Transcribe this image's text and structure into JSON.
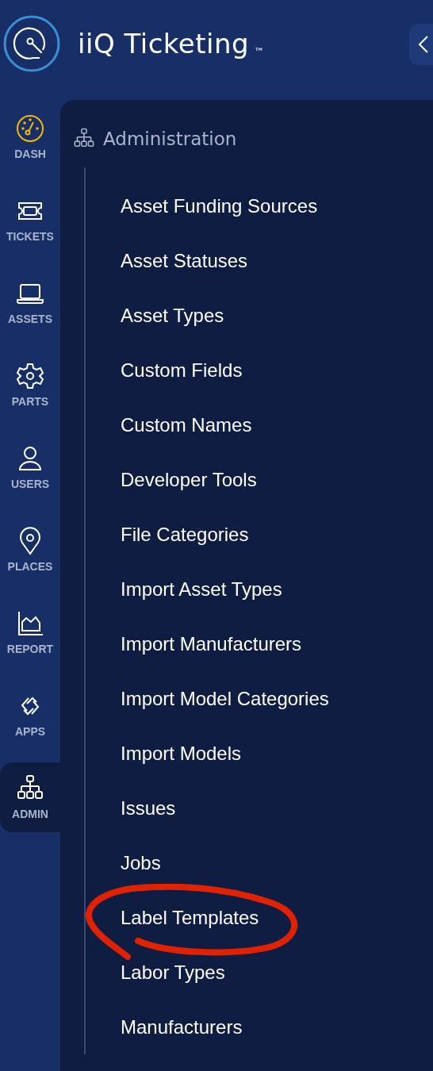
{
  "header": {
    "title": "iiQ Ticketing",
    "trademark": "™"
  },
  "rail": [
    {
      "label": "DASH",
      "selected": false
    },
    {
      "label": "TICKETS",
      "selected": false
    },
    {
      "label": "ASSETS",
      "selected": false
    },
    {
      "label": "PARTS",
      "selected": false
    },
    {
      "label": "USERS",
      "selected": false
    },
    {
      "label": "PLACES",
      "selected": false
    },
    {
      "label": "REPORT",
      "selected": false
    },
    {
      "label": "APPS",
      "selected": false
    },
    {
      "label": "ADMIN",
      "selected": true
    }
  ],
  "panel": {
    "title": "Administration",
    "items": [
      {
        "label": "Asset Funding Sources",
        "highlighted": false
      },
      {
        "label": "Asset Statuses",
        "highlighted": false
      },
      {
        "label": "Asset Types",
        "highlighted": false
      },
      {
        "label": "Custom Fields",
        "highlighted": false
      },
      {
        "label": "Custom Names",
        "highlighted": false
      },
      {
        "label": "Developer Tools",
        "highlighted": false
      },
      {
        "label": "File Categories",
        "highlighted": false
      },
      {
        "label": "Import Asset Types",
        "highlighted": false
      },
      {
        "label": "Import Manufacturers",
        "highlighted": false
      },
      {
        "label": "Import Model Categories",
        "highlighted": false
      },
      {
        "label": "Import Models",
        "highlighted": false
      },
      {
        "label": "Issues",
        "highlighted": false
      },
      {
        "label": "Jobs",
        "highlighted": false
      },
      {
        "label": "Label Templates",
        "highlighted": true
      },
      {
        "label": "Labor Types",
        "highlighted": false
      },
      {
        "label": "Manufacturers",
        "highlighted": false
      }
    ]
  }
}
